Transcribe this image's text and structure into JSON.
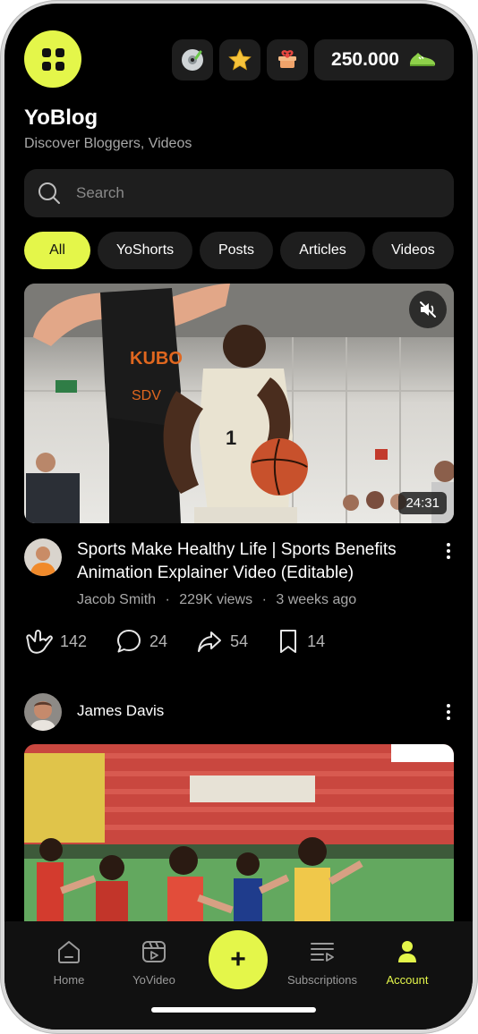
{
  "header": {
    "title": "YoBlog",
    "subtitle": "Discover Bloggers, Videos",
    "coins": "250.000",
    "icons": [
      "disc-icon",
      "star-icon",
      "gift-icon",
      "sneaker-icon"
    ]
  },
  "search": {
    "placeholder": "Search"
  },
  "filters": [
    "All",
    "YoShorts",
    "Posts",
    "Articles",
    "Videos"
  ],
  "video": {
    "duration": "24:31",
    "title": "Sports Make Healthy Life | Sports Benefits Animation Explainer Video (Editable)",
    "author": "Jacob Smith",
    "views": "229K views",
    "age": "3 weeks ago",
    "likes": "142",
    "comments": "24",
    "shares": "54",
    "saves": "14"
  },
  "post": {
    "author": "James Davis"
  },
  "nav": {
    "home": "Home",
    "yovideo": "YoVideo",
    "add": "+",
    "subscriptions": "Subscriptions",
    "account": "Account"
  },
  "colors": {
    "accent": "#e4f64a",
    "surface": "#1e1e1e",
    "background": "#000000"
  }
}
